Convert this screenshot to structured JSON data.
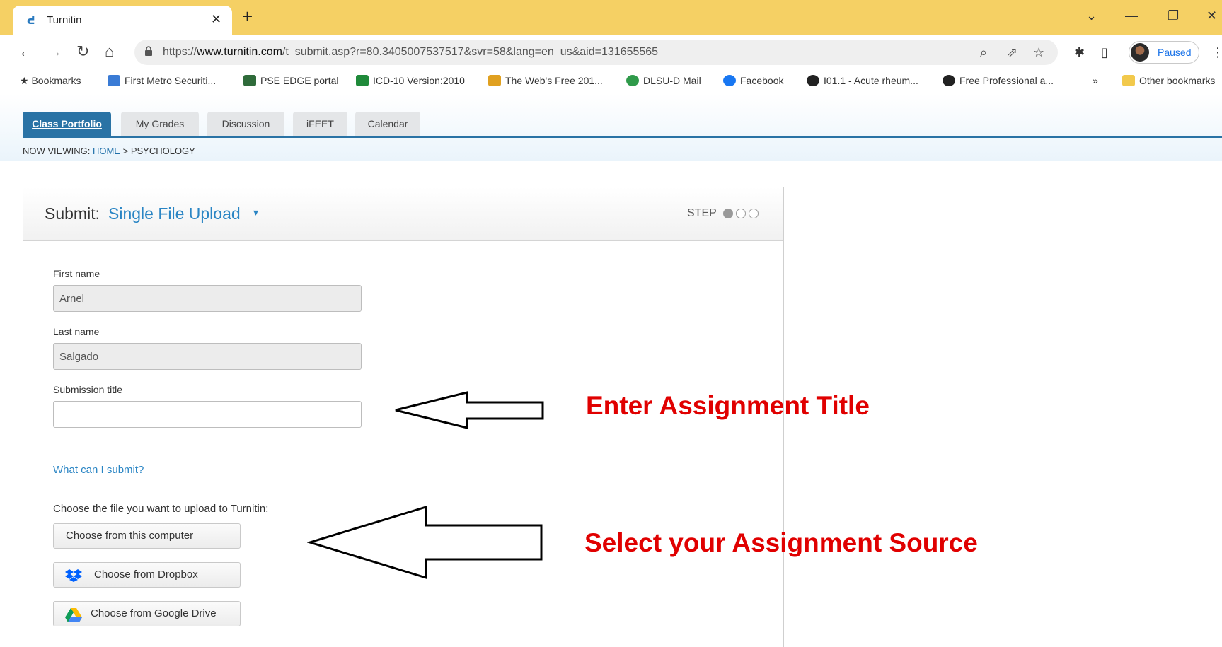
{
  "browser": {
    "tab_title": "Turnitin",
    "url_prefix": "https://",
    "url_host": "www.turnitin.com",
    "url_path": "/t_submit.asp?r=80.3405007537517&svr=58&lang=en_us&aid=131655565",
    "profile_label": "Paused"
  },
  "bookmarks": [
    {
      "label": "Bookmarks",
      "color": "#333333"
    },
    {
      "label": "First Metro Securiti...",
      "color": "#3a7bd5"
    },
    {
      "label": "PSE EDGE portal",
      "color": "#2f6b3a"
    },
    {
      "label": "ICD-10 Version:2010",
      "color": "#1f8a3a"
    },
    {
      "label": "The Web's Free 201...",
      "color": "#e0a020"
    },
    {
      "label": "DLSU-D Mail",
      "color": "#2f9a4a"
    },
    {
      "label": "Facebook",
      "color": "#1877f2"
    },
    {
      "label": "I01.1 - Acute rheum...",
      "color": "#222222"
    },
    {
      "label": "Free Professional a...",
      "color": "#222222"
    },
    {
      "label": "Other bookmarks",
      "color": "#f2c94c"
    }
  ],
  "nav_tabs": [
    {
      "label": "Class Portfolio",
      "active": true
    },
    {
      "label": "My Grades",
      "active": false
    },
    {
      "label": "Discussion",
      "active": false
    },
    {
      "label": "iFEET",
      "active": false
    },
    {
      "label": "Calendar",
      "active": false
    }
  ],
  "breadcrumb": {
    "prefix": "NOW VIEWING:",
    "home": "HOME",
    "separator": ">",
    "current": "PSYCHOLOGY"
  },
  "submit": {
    "label": "Submit:",
    "mode": "Single File Upload",
    "step_label": "STEP"
  },
  "form": {
    "first_name_label": "First name",
    "first_name_value": "Arnel",
    "last_name_label": "Last name",
    "last_name_value": "Salgado",
    "submission_title_label": "Submission title",
    "submission_title_value": "",
    "what_can_submit": "What can I submit?",
    "choose_file_prompt": "Choose the file you want to upload to Turnitin:",
    "btn_computer": "Choose from this computer",
    "btn_dropbox": "Choose from Dropbox",
    "btn_gdrive": "Choose from Google Drive"
  },
  "annotations": {
    "title_hint": "Enter Assignment Title",
    "source_hint": "Select your Assignment Source",
    "color": "#e00000"
  }
}
